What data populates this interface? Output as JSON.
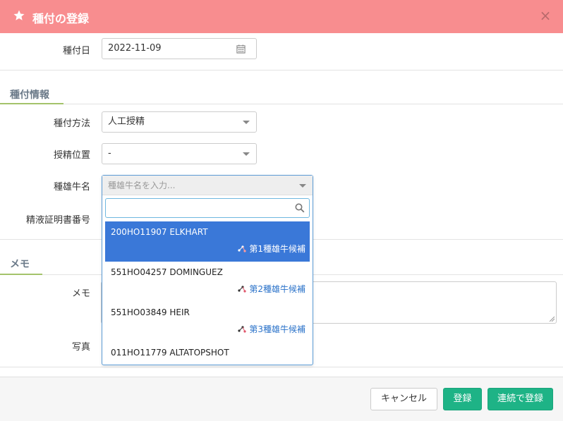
{
  "modal": {
    "title": "種付の登録",
    "close": "×"
  },
  "fields": {
    "date": {
      "label": "種付日",
      "value": "2022-11-09"
    },
    "method": {
      "label": "種付方法",
      "value": "人工授精"
    },
    "position": {
      "label": "授精位置",
      "value": "-"
    },
    "bull": {
      "label": "種雄牛名",
      "placeholder": "種雄牛名を入力..."
    },
    "semen_cert": {
      "label": "精液証明書番号"
    },
    "memo": {
      "label": "メモ"
    },
    "photo": {
      "label": "写真"
    }
  },
  "sections": {
    "breeding_info": "種付情報",
    "memo": "メモ"
  },
  "dropdown": {
    "options": [
      {
        "name": "200HO11907 ELKHART",
        "candidate": "第1種雄牛候補",
        "selected": true
      },
      {
        "name": "551HO04257 DOMINGUEZ",
        "candidate": "第2種雄牛候補",
        "selected": false
      },
      {
        "name": "551HO03849 HEIR",
        "candidate": "第3種雄牛候補",
        "selected": false
      },
      {
        "name": "011HO11779 ALTATOPSHOT",
        "candidate": "",
        "selected": false
      }
    ]
  },
  "buttons": {
    "cancel": "キャンセル",
    "register": "登録",
    "register_continue": "連続で登録"
  },
  "colors": {
    "header": "#f88d8f",
    "primary": "#1eb386",
    "highlight": "#3a78d8",
    "section_accent": "#a4c36b"
  },
  "icons": {
    "header": "star-icon",
    "date": "calendar-icon",
    "search": "search-icon",
    "candidate": "candidate-icon"
  }
}
